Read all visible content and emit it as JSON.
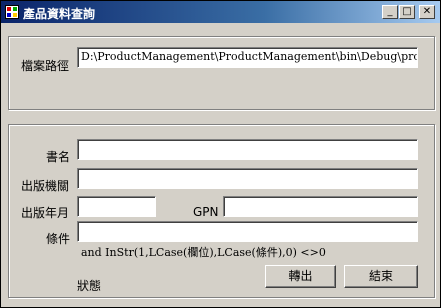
{
  "window": {
    "title": "產品資料查詢"
  },
  "titlebar_buttons": {
    "minimize": "_",
    "maximize": "□",
    "close": "✕"
  },
  "file_group": {
    "path_label": "檔案路徑",
    "path_value": "D:\\ProductManagement\\ProductManagement\\bin\\Debug\\product.mdb"
  },
  "search": {
    "title_label": "書名",
    "title_value": "",
    "publisher_label": "出版機關",
    "publisher_value": "",
    "pubdate_label": "出版年月",
    "pubdate_value": "",
    "gpn_label": "GPN",
    "gpn_value": "",
    "condition_label": "條件",
    "condition_value": "",
    "hint": "and InStr(1,LCase(欄位),LCase(條件),0) <>0",
    "status_label": "狀態"
  },
  "buttons": {
    "export": "轉出",
    "close": "結束"
  }
}
